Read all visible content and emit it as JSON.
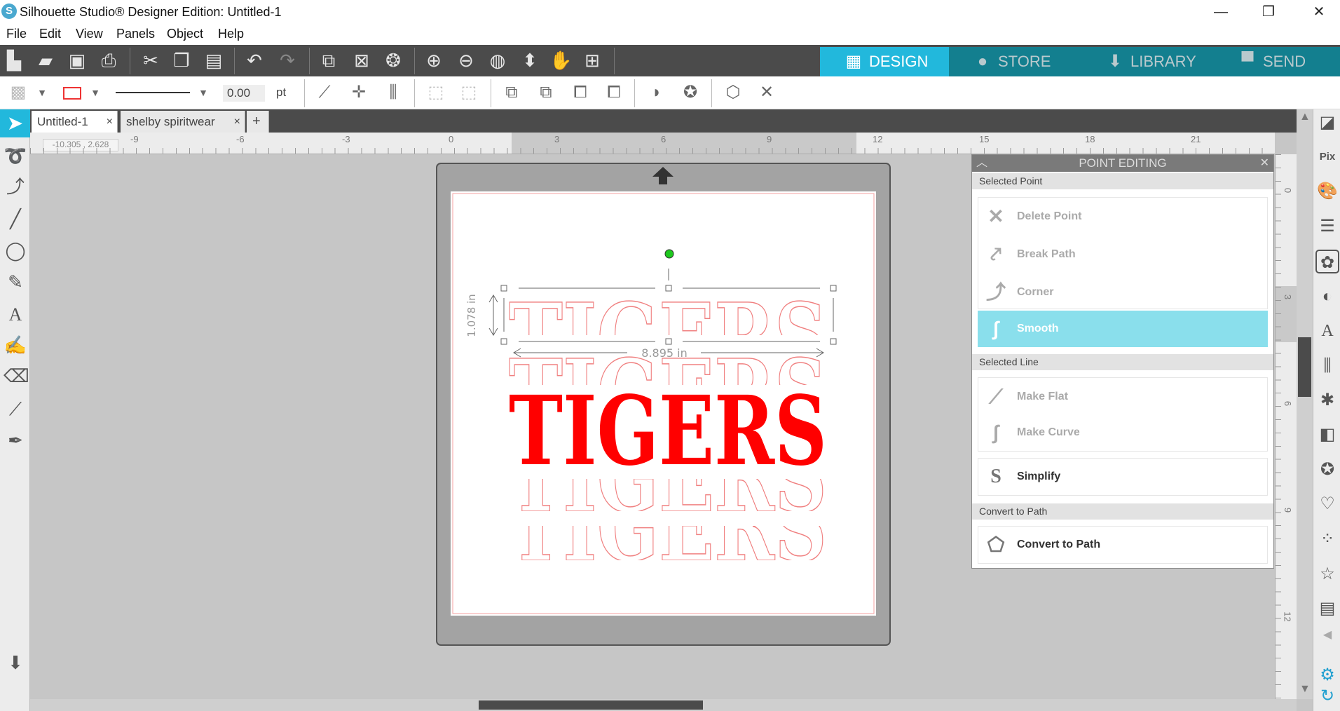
{
  "window": {
    "title": "Silhouette Studio® Designer Edition: Untitled-1",
    "minimize": "—",
    "restore": "❐",
    "close": "✕"
  },
  "menu": [
    "File",
    "Edit",
    "View",
    "Panels",
    "Object",
    "Help"
  ],
  "nav_tabs": [
    {
      "label": "DESIGN",
      "active": true
    },
    {
      "label": "STORE"
    },
    {
      "label": "LIBRARY"
    },
    {
      "label": "SEND"
    }
  ],
  "toolbar2": {
    "line_width": "0.00",
    "unit": "pt"
  },
  "doc_tabs": [
    {
      "label": "Untitled-1",
      "close": "×"
    },
    {
      "label": "shelby spiritwear",
      "close": "×"
    }
  ],
  "add_tab": "+",
  "ruler": {
    "readout": "-10.305 , 2.628",
    "h_labels": [
      "-9",
      "-6",
      "-3",
      "0",
      "3",
      "6",
      "9",
      "12",
      "15",
      "18",
      "21"
    ],
    "v_labels": [
      "0",
      "3",
      "6",
      "9",
      "12"
    ]
  },
  "canvas": {
    "text": "TIGERS",
    "height_label": "1.078 in",
    "width_label": "8.895 in",
    "text_color": "#ff0000",
    "outline_color": "#f08080"
  },
  "panel": {
    "title": "POINT EDITING",
    "close": "✕",
    "sections": {
      "selected_point": "Selected Point",
      "selected_line": "Selected Line",
      "convert": "Convert to Path"
    },
    "items": {
      "delete": "Delete Point",
      "break": "Break Path",
      "corner": "Corner",
      "smooth": "Smooth",
      "flat": "Make Flat",
      "curve": "Make Curve",
      "simplify": "Simplify",
      "convert": "Convert to Path"
    },
    "selected": "Smooth"
  },
  "colors": {
    "accent": "#22b8dc",
    "nav": "#137f8f",
    "highlight": "#8adfec"
  }
}
